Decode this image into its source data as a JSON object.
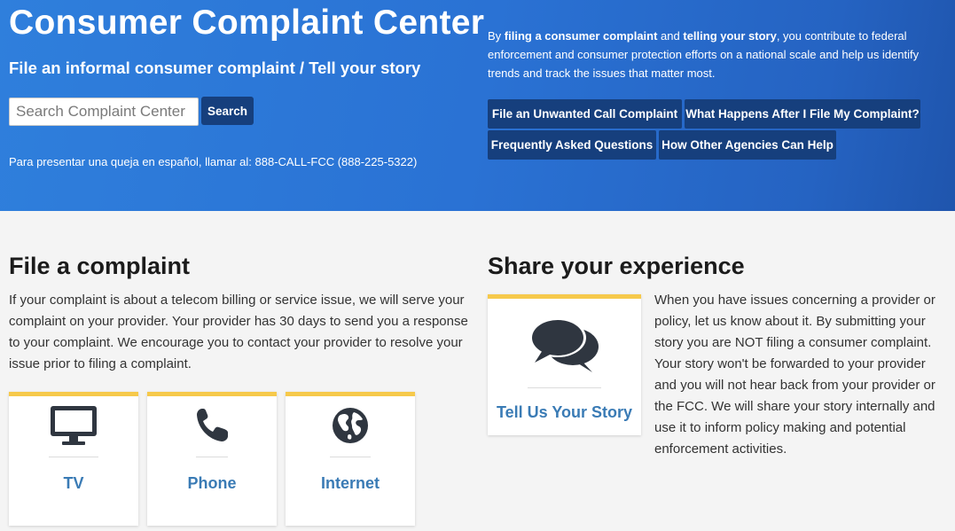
{
  "hero": {
    "title": "Consumer Complaint Center",
    "subtitle": "File an informal consumer complaint / Tell your story",
    "search": {
      "placeholder": "Search Complaint Center",
      "button_label": "Search"
    },
    "spanish_note": "Para presentar una queja en español, llamar al: 888-CALL-FCC (888-225-5322)",
    "intro": {
      "part1": "By ",
      "bold1": "filing a consumer complaint",
      "part2": " and ",
      "bold2": "telling your story",
      "part3": ", you contribute to federal enforcement and consumer protection efforts on a national scale and help us identify trends and track the issues that matter most."
    },
    "links": [
      "File an Unwanted Call Complaint",
      "What Happens After I File My Complaint?",
      "Frequently Asked Questions",
      "How Other Agencies Can Help"
    ]
  },
  "file_complaint": {
    "heading": "File a complaint",
    "body": "If your complaint is about a telecom billing or service issue, we will serve your complaint on your provider. Your provider has 30 days to send you a response to your complaint. We encourage you to contact your provider to resolve your issue prior to filing a complaint.",
    "cards": [
      {
        "label": "TV",
        "icon": "tv-icon"
      },
      {
        "label": "Phone",
        "icon": "phone-icon"
      },
      {
        "label": "Internet",
        "icon": "globe-icon"
      }
    ]
  },
  "share_experience": {
    "heading": "Share your experience",
    "card_label": "Tell Us Your Story",
    "card_icon": "speech-bubbles-icon",
    "body": "When you have issues concerning a provider or policy, let us know about it. By submitting your story you are NOT filing a consumer complaint. Your story won't be forwarded to your provider and you will not hear back from your provider or the FCC. We will share your story internally and use it to inform policy making and potential enforcement activities."
  },
  "colors": {
    "hero_blue": "#2a72d4",
    "button_navy": "#163f7d",
    "card_accent_yellow": "#f6c94b",
    "card_label_blue": "#3a7bb5",
    "icon_dark": "#2f3640"
  }
}
